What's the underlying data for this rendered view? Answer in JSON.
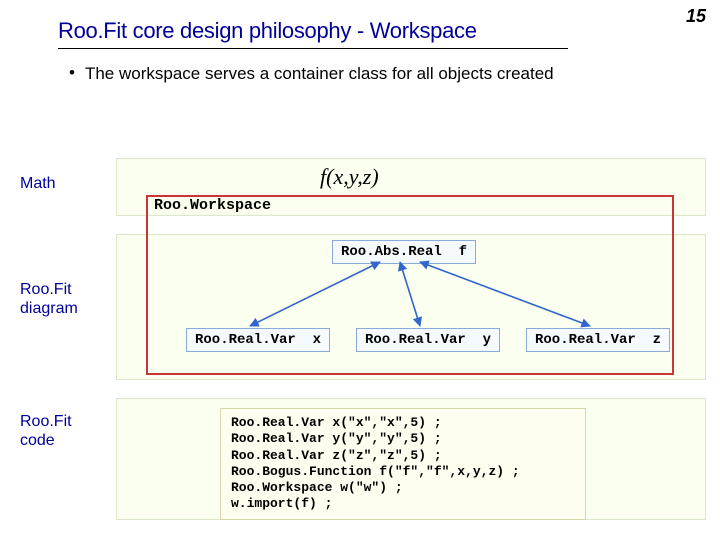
{
  "page_number": "15",
  "title": "Roo.Fit core design philosophy - Workspace",
  "bullet": "The workspace serves a container class for all objects created",
  "labels": {
    "math": "Math",
    "diagram": "Roo.Fit\ndiagram",
    "code": "Roo.Fit\ncode"
  },
  "workspace_label": "Roo.Workspace",
  "formula": "f(x,y,z)",
  "nodes": {
    "f": "Roo.Abs.Real  f",
    "x": "Roo.Real.Var  x",
    "y": "Roo.Real.Var  y",
    "z": "Roo.Real.Var  z"
  },
  "code_lines": [
    "Roo.Real.Var x(\"x\",\"x\",5) ;",
    "Roo.Real.Var y(\"y\",\"y\",5) ;",
    "Roo.Real.Var z(\"z\",\"z\",5) ;",
    "Roo.Bogus.Function f(\"f\",\"f\",x,y,z) ;",
    "Roo.Workspace w(\"w\") ;",
    "w.import(f) ;"
  ]
}
